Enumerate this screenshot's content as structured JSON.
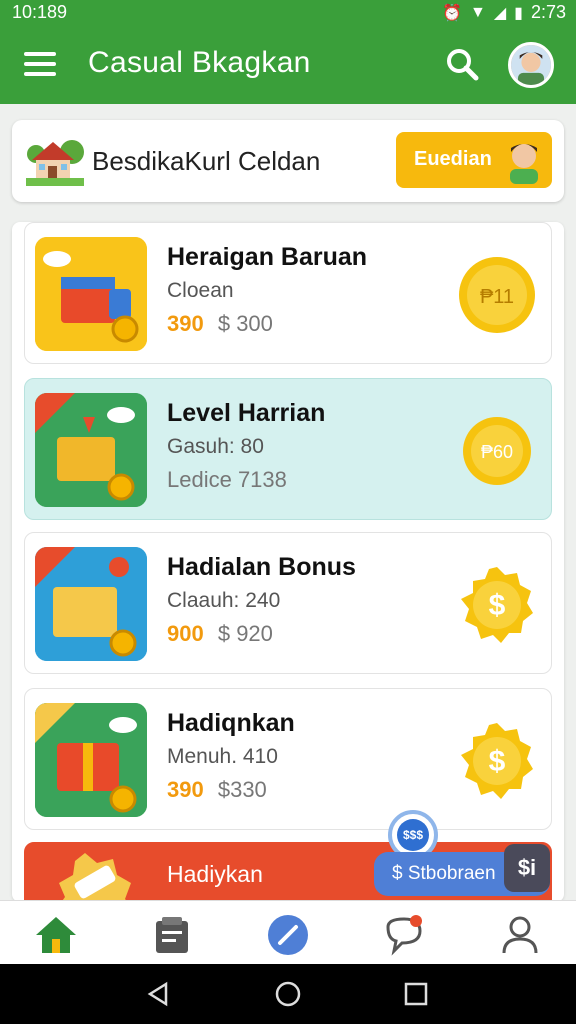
{
  "status_bar": {
    "time": "10:189",
    "battery_time": "2:73"
  },
  "app_bar": {
    "title": "Casual Bkagkan",
    "menu_icon": "hamburger-icon",
    "search_icon": "search-icon",
    "avatar_icon": "avatar"
  },
  "banner": {
    "title": "BesdikaKurl Celdan",
    "button_label": "Euedian"
  },
  "cards": [
    {
      "title": "Heraigan Baruan",
      "subtitle": "Cloean",
      "price_main": "390",
      "price_alt": "$ 300",
      "coin_label": "₱11",
      "highlight": false
    },
    {
      "title": "Level Harrian",
      "subtitle": "Gasuh: 80",
      "price_main": "",
      "price_alt": "Ledice 7138",
      "coin_label": "₱60",
      "highlight": true
    },
    {
      "title": "Hadialan Bonus",
      "subtitle": "Claauh: 240",
      "price_main": "900",
      "price_alt": "$ 920",
      "coin_label": "$",
      "highlight": false
    },
    {
      "title": "Hadiqnkan",
      "subtitle": "Menuh. 410",
      "price_main": "390",
      "price_alt": "$330",
      "coin_label": "$",
      "highlight": false
    },
    {
      "title": "Hadiykan",
      "subtitle": "",
      "price_main": "",
      "price_alt": "",
      "coin_label": "",
      "highlight": false
    }
  ],
  "floating_chip": {
    "label": "$ Stbobraen",
    "badge": "$i"
  },
  "bottom_nav": [
    "home-icon",
    "clipboard-icon",
    "edit-icon",
    "chat-icon",
    "profile-icon"
  ],
  "colors": {
    "primary": "#3a9f3a",
    "accent": "#f7b90d",
    "highlight_card": "#d5f1ef",
    "chip": "#4f7fd6",
    "last_card": "#e74c2c"
  }
}
